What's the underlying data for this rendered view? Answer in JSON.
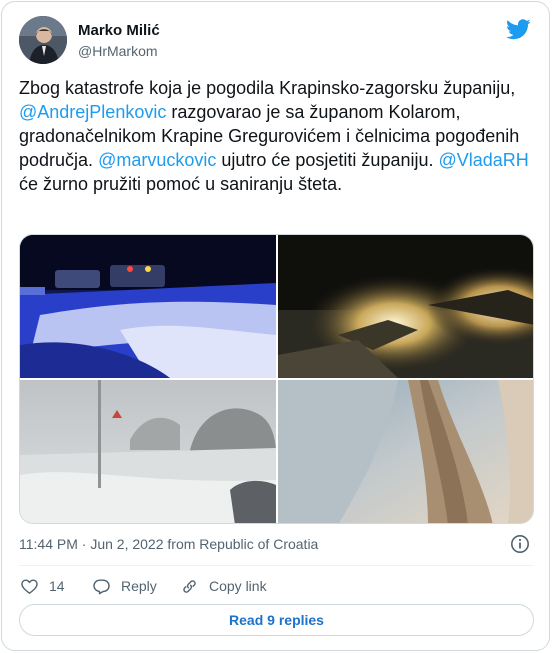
{
  "author": {
    "name": "Marko Milić",
    "handle": "@HrMarkom"
  },
  "tweet": {
    "segments": [
      {
        "text": "Zbog katastrofe koja je pogodila Krapinsko-zagorsku županiju, ",
        "type": "text"
      },
      {
        "text": "@AndrejPlenkovic",
        "type": "mention"
      },
      {
        "text": " razgovarao je sa županom Kolarom, gradonačelnikom Krapine Gregurovićem i čelnicima pogođenih područja. ",
        "type": "text"
      },
      {
        "text": "@marvuckovic",
        "type": "mention"
      },
      {
        "text": " ujutro će posjetiti županiju. ",
        "type": "text"
      },
      {
        "text": "@VladaRH",
        "type": "mention"
      },
      {
        "text": " će žurno pružiti pomoć u saniranju šteta.",
        "type": "text"
      }
    ],
    "timestamp": "11:44 PM · Jun 2, 2022 from Republic of Croatia"
  },
  "media": {
    "photos": [
      {
        "icon": "night-hail-road-photo"
      },
      {
        "icon": "night-car-headlights-photo"
      },
      {
        "icon": "hail-storm-field-photo"
      },
      {
        "icon": "hail-covered-ground-photo"
      }
    ]
  },
  "actions": {
    "like_count": "14",
    "reply_label": "Reply",
    "copy_label": "Copy link",
    "read_replies_label": "Read 9 replies"
  },
  "colors": {
    "accent": "#1d9bf0",
    "muted": "#536471",
    "border": "#cfd9de"
  }
}
